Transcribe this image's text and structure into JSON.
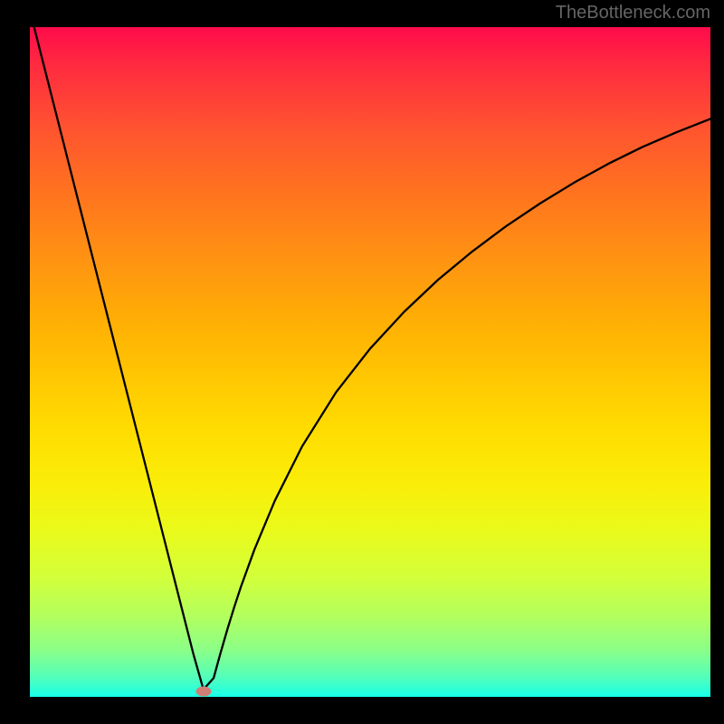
{
  "watermark": "TheBottleneck.com",
  "chart_data": {
    "type": "line",
    "title": "",
    "xlabel": "",
    "ylabel": "",
    "xlim": [
      0,
      100
    ],
    "ylim": [
      0,
      100
    ],
    "grid": false,
    "axes_visible": false,
    "annotations": [],
    "series": [
      {
        "name": "bottleneck-curve",
        "color": "#000000",
        "x": [
          0,
          2,
          4,
          6,
          8,
          10,
          12,
          14,
          16,
          18,
          20,
          22,
          24,
          25.5,
          27,
          28,
          29,
          30,
          31,
          33,
          36,
          40,
          45,
          50,
          55,
          60,
          65,
          70,
          75,
          80,
          85,
          90,
          95,
          100
        ],
        "y": [
          102.5,
          94.5,
          86.5,
          78.5,
          70.5,
          62.5,
          54.5,
          46.5,
          38.5,
          30.5,
          22.5,
          14.5,
          6.5,
          1.1,
          2.8,
          6.5,
          10,
          13.3,
          16.4,
          22,
          29.3,
          37.4,
          45.5,
          52.0,
          57.5,
          62.3,
          66.5,
          70.3,
          73.7,
          76.8,
          79.6,
          82.1,
          84.3,
          86.3
        ]
      }
    ],
    "marker": {
      "x": 25.5,
      "y": 0.8,
      "color": "#cf7d75"
    },
    "background": {
      "type": "vertical-gradient",
      "top_color": "#ff0b4b",
      "bottom_color": "#17ffe9",
      "description": "red-orange-yellow-green spectrum"
    }
  }
}
